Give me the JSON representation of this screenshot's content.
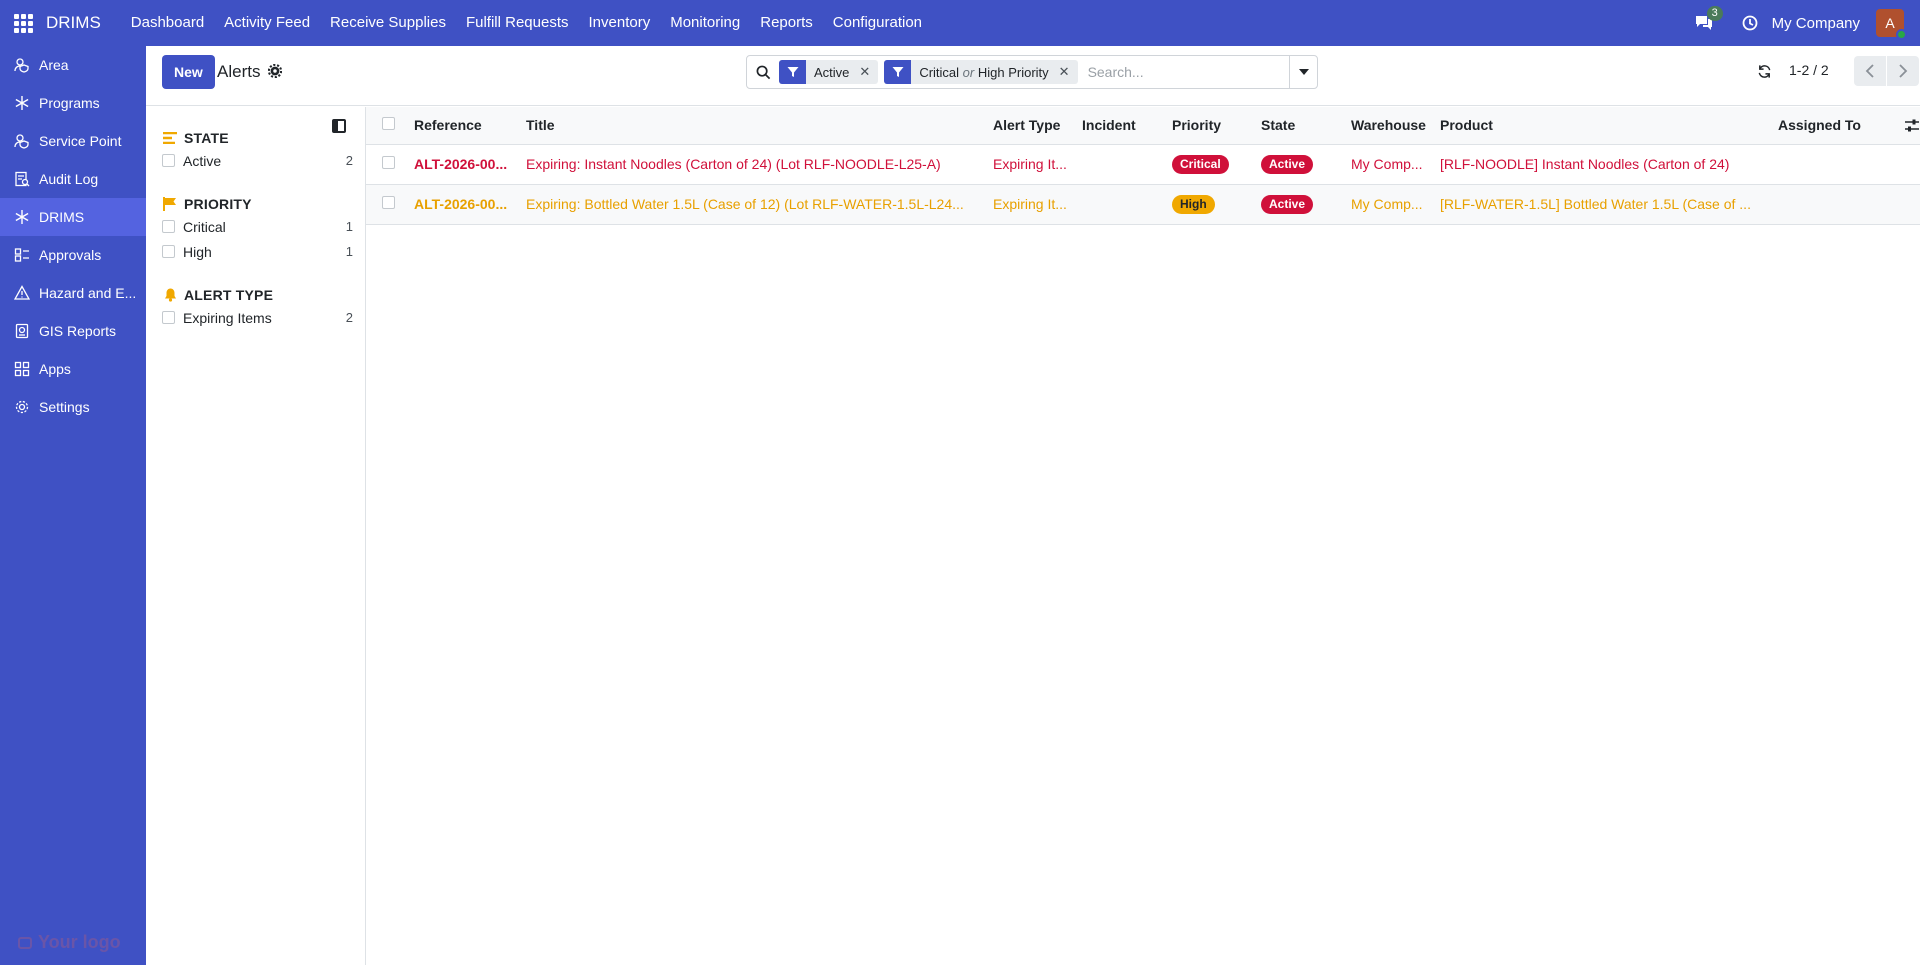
{
  "navbar": {
    "brand": "DRIMS",
    "menu": [
      "Dashboard",
      "Activity Feed",
      "Receive Supplies",
      "Fulfill Requests",
      "Inventory",
      "Monitoring",
      "Reports",
      "Configuration"
    ],
    "chat_count": "3",
    "company": "My Company",
    "avatar_letter": "A"
  },
  "sidebar": {
    "items": [
      {
        "label": "Area",
        "icon": "user-shield-icon"
      },
      {
        "label": "Programs",
        "icon": "snowflake-icon"
      },
      {
        "label": "Service Point",
        "icon": "user-shield-icon"
      },
      {
        "label": "Audit Log",
        "icon": "audit-icon"
      },
      {
        "label": "DRIMS",
        "icon": "snowflake-icon"
      },
      {
        "label": "Approvals",
        "icon": "approvals-icon"
      },
      {
        "label": "Hazard and E...",
        "icon": "warning-icon"
      },
      {
        "label": "GIS Reports",
        "icon": "report-icon"
      },
      {
        "label": "Apps",
        "icon": "apps-icon"
      },
      {
        "label": "Settings",
        "icon": "gear-icon"
      }
    ],
    "logo_text": "Your logo"
  },
  "control": {
    "new_label": "New",
    "title": "Alerts",
    "facets": [
      {
        "label": "Active"
      },
      {
        "part1": "Critical",
        "or": "or",
        "part2": "High Priority"
      }
    ],
    "search_placeholder": "Search...",
    "pager": "1-2 / 2"
  },
  "search_panel": {
    "sections": [
      {
        "title": "STATE",
        "icon": "state-icon",
        "items": [
          {
            "label": "Active",
            "count": "2"
          }
        ]
      },
      {
        "title": "PRIORITY",
        "icon": "flag-icon",
        "items": [
          {
            "label": "Critical",
            "count": "1"
          },
          {
            "label": "High",
            "count": "1"
          }
        ]
      },
      {
        "title": "ALERT TYPE",
        "icon": "bell-icon",
        "items": [
          {
            "label": "Expiring Items",
            "count": "2"
          }
        ]
      }
    ]
  },
  "table": {
    "columns": [
      "Reference",
      "Title",
      "Alert Type",
      "Incident",
      "Priority",
      "State",
      "Warehouse",
      "Product",
      "Assigned To"
    ],
    "rows": [
      {
        "reference": "ALT-2026-00...",
        "title": "Expiring: Instant Noodles (Carton of 24) (Lot RLF-NOODLE-L25-A)",
        "alert_type": "Expiring It...",
        "incident": "",
        "priority": "Critical",
        "state": "Active",
        "warehouse": "My Comp...",
        "product": "[RLF-NOODLE] Instant Noodles (Carton of 24)",
        "assigned_to": ""
      },
      {
        "reference": "ALT-2026-00...",
        "title": "Expiring: Bottled Water 1.5L (Case of 12) (Lot RLF-WATER-1.5L-L24...",
        "alert_type": "Expiring It...",
        "incident": "",
        "priority": "High",
        "state": "Active",
        "warehouse": "My Comp...",
        "product": "[RLF-WATER-1.5L] Bottled Water 1.5L (Case of ...",
        "assigned_to": ""
      }
    ]
  },
  "colors": {
    "brand": "#3f51c4",
    "critical": "#d0103a",
    "high": "#e8a000"
  }
}
